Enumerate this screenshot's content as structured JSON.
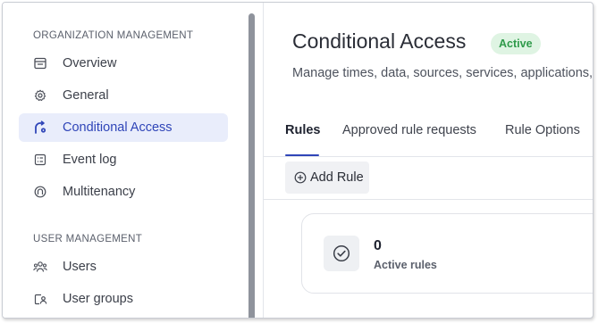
{
  "sidebar": {
    "sections": [
      {
        "title": "ORGANIZATION MANAGEMENT"
      },
      {
        "title": "USER MANAGEMENT"
      }
    ],
    "items": [
      {
        "label": "Overview",
        "icon": "overview-icon"
      },
      {
        "label": "General",
        "icon": "gear-icon"
      },
      {
        "label": "Conditional Access",
        "icon": "conditional-access-icon",
        "active": true
      },
      {
        "label": "Event log",
        "icon": "event-log-icon"
      },
      {
        "label": "Multitenancy",
        "icon": "multitenancy-icon"
      },
      {
        "label": "Users",
        "icon": "users-icon"
      },
      {
        "label": "User groups",
        "icon": "user-groups-icon"
      }
    ]
  },
  "header": {
    "title": "Conditional Access",
    "status": "Active",
    "subtitle": "Manage times, data, sources, services, applications,"
  },
  "tabs": [
    {
      "label": "Rules",
      "active": true
    },
    {
      "label": "Approved rule requests"
    },
    {
      "label": "Rule Options"
    }
  ],
  "toolbar": {
    "add_rule_label": "Add Rule"
  },
  "stats": {
    "value": "0",
    "label": "Active rules"
  },
  "colors": {
    "accent": "#2f45b8",
    "active_bg": "#e9edfb",
    "badge_bg": "#dff4e3",
    "badge_text": "#2f9a4a"
  }
}
